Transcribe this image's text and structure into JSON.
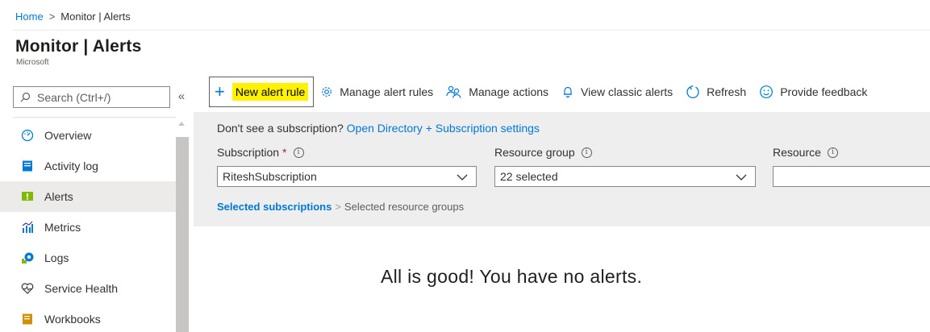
{
  "breadcrumb": {
    "home": "Home",
    "separator": ">",
    "current": "Monitor | Alerts"
  },
  "header": {
    "title": "Monitor | Alerts",
    "subtitle": "Microsoft"
  },
  "sidebar": {
    "search_placeholder": "Search (Ctrl+/)",
    "collapse_label": "«",
    "items": [
      {
        "label": "Overview",
        "icon": "overview-icon",
        "active": false
      },
      {
        "label": "Activity log",
        "icon": "activity-log-icon",
        "active": false
      },
      {
        "label": "Alerts",
        "icon": "alerts-icon",
        "active": true
      },
      {
        "label": "Metrics",
        "icon": "metrics-icon",
        "active": false
      },
      {
        "label": "Logs",
        "icon": "logs-icon",
        "active": false
      },
      {
        "label": "Service Health",
        "icon": "heart-icon",
        "active": false
      },
      {
        "label": "Workbooks",
        "icon": "workbooks-icon",
        "active": false
      }
    ]
  },
  "toolbar": {
    "new_alert_rule": "New alert rule",
    "manage_alert_rules": "Manage alert rules",
    "manage_actions": "Manage actions",
    "view_classic_alerts": "View classic alerts",
    "refresh": "Refresh",
    "provide_feedback": "Provide feedback"
  },
  "filters": {
    "notice_text": "Don't see a subscription?",
    "notice_link": "Open Directory + Subscription settings",
    "subscription": {
      "label": "Subscription",
      "required_mark": "*",
      "value": "RiteshSubscription"
    },
    "resource_group": {
      "label": "Resource group",
      "value": "22 selected"
    },
    "resource": {
      "label": "Resource",
      "value": ""
    },
    "info_glyph": "i",
    "steps": {
      "active": "Selected subscriptions",
      "separator": ">",
      "rest": "Selected resource groups"
    }
  },
  "main": {
    "empty_message": "All is good! You have no alerts."
  },
  "colors": {
    "accent": "#0078d4",
    "highlight": "#fff200",
    "required": "#a4262c",
    "band": "#eeeeee"
  }
}
